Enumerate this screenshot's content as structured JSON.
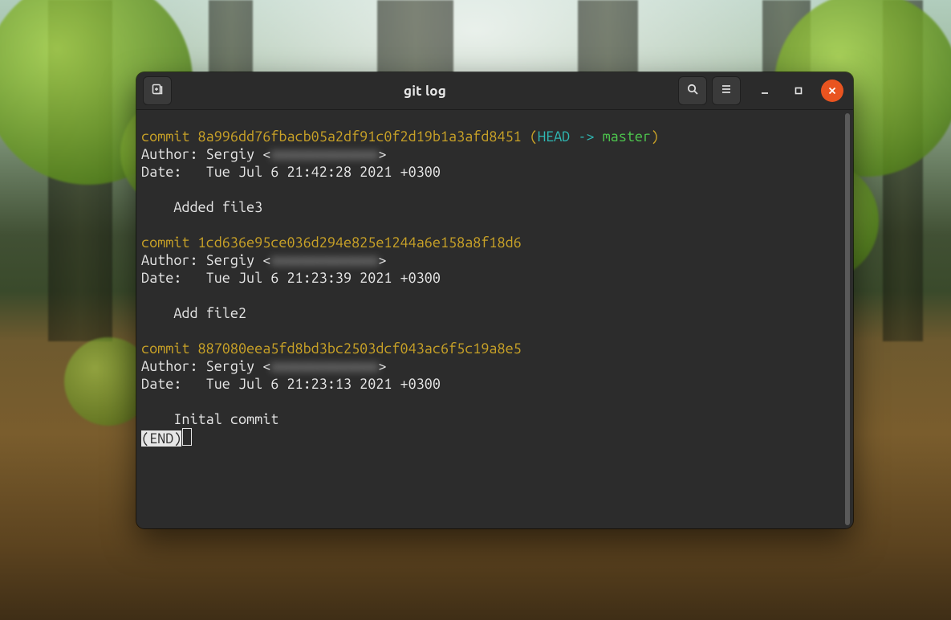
{
  "window": {
    "title": "git log"
  },
  "log": {
    "author_label": "Author:",
    "date_label": "Date:  ",
    "author_name": "Sergiy",
    "author_email": "xxxxxxxxxxxxxx",
    "ref_head": "HEAD",
    "ref_arrow": " -> ",
    "ref_branch": "master",
    "end_marker": "(END)",
    "commits": [
      {
        "hash": "8a996dd76fbacb05a2df91c0f2d19b1a3afd8451",
        "date": "Tue Jul 6 21:42:28 2021 +0300",
        "message": "Added file3",
        "is_head": true
      },
      {
        "hash": "1cd636e95ce036d294e825e1244a6e158a8f18d6",
        "date": "Tue Jul 6 21:23:39 2021 +0300",
        "message": "Add file2",
        "is_head": false
      },
      {
        "hash": "887080eea5fd8bd3bc2503dcf043ac6f5c19a8e5",
        "date": "Tue Jul 6 21:23:13 2021 +0300",
        "message": "Inital commit",
        "is_head": false
      }
    ]
  }
}
